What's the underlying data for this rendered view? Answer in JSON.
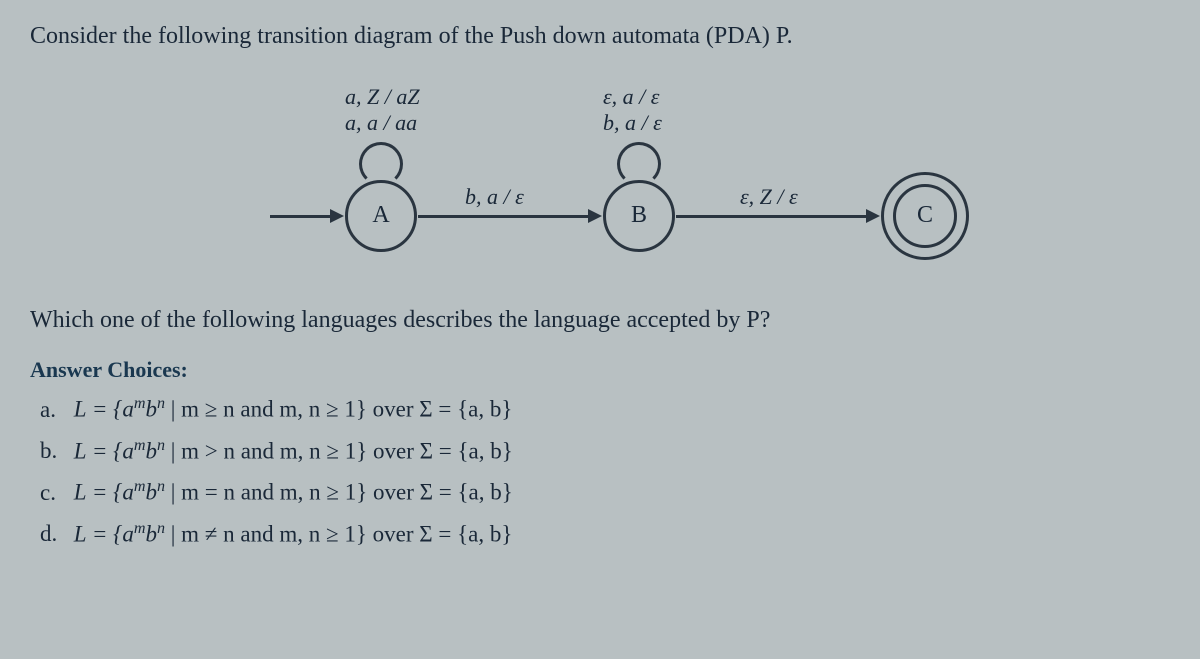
{
  "question": "Consider the following transition diagram of the Push down automata (PDA) P.",
  "diagram": {
    "stateA": "A",
    "stateB": "B",
    "stateC": "C",
    "loopA_line1": "a, Z / aZ",
    "loopA_line2": "a, a / aa",
    "loopB_line1": "ε, a / ε",
    "loopB_line2": "b, a / ε",
    "edgeAB": "b, a / ε",
    "edgeBC": "ε, Z / ε"
  },
  "subquestion": "Which one of the following languages describes the language accepted by P?",
  "choices_header": "Answer Choices:",
  "choices": {
    "a": {
      "letter": "a.",
      "prefix": "L = {a",
      "sup1": "m",
      "mid": "b",
      "sup2": "n",
      "rest": " | m ≥ n and m, n ≥ 1} over Σ = {a, b}"
    },
    "b": {
      "letter": "b.",
      "prefix": "L = {a",
      "sup1": "m",
      "mid": "b",
      "sup2": "n",
      "rest": " | m > n and m, n ≥ 1} over Σ = {a, b}"
    },
    "c": {
      "letter": "c.",
      "prefix": "L = {a",
      "sup1": "m",
      "mid": "b",
      "sup2": "n",
      "rest": " | m = n and m, n ≥ 1} over Σ = {a, b}"
    },
    "d": {
      "letter": "d.",
      "prefix": "L = {a",
      "sup1": "m",
      "mid": "b",
      "sup2": "n",
      "rest": " | m ≠ n and m, n ≥ 1} over Σ = {a, b}"
    }
  }
}
